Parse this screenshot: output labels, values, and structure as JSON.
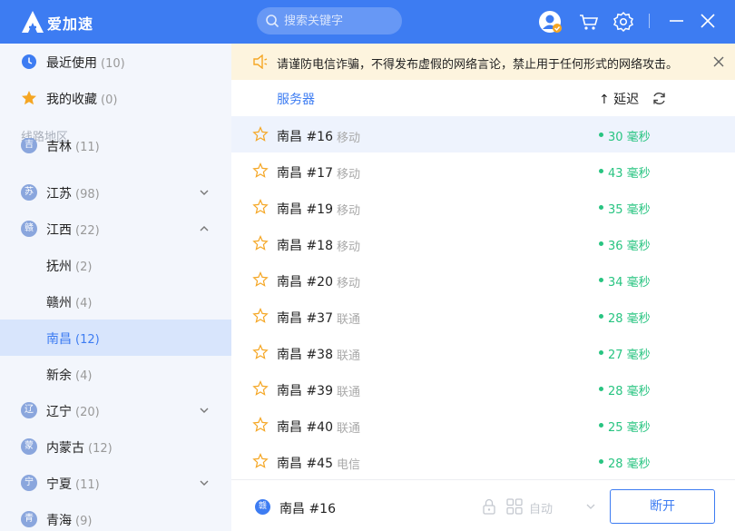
{
  "app": {
    "title": "爱加速"
  },
  "header": {
    "search_placeholder": "搜索关键字"
  },
  "sidebar": {
    "recent": {
      "label": "最近使用",
      "count": "(10)"
    },
    "favorites": {
      "label": "我的收藏",
      "count": "(0)"
    },
    "section_title": "线路地区",
    "regions": [
      {
        "badge": "吉",
        "label": "吉林",
        "count": "(11)"
      },
      {
        "badge": "苏",
        "label": "江苏",
        "count": "(98)"
      },
      {
        "badge": "赣",
        "label": "江西",
        "count": "(22)"
      },
      {
        "label": "抚州",
        "count": "(2)"
      },
      {
        "label": "赣州",
        "count": "(4)"
      },
      {
        "label": "南昌",
        "count": "(12)"
      },
      {
        "label": "新余",
        "count": "(4)"
      },
      {
        "badge": "辽",
        "label": "辽宁",
        "count": "(20)"
      },
      {
        "badge": "蒙",
        "label": "内蒙古",
        "count": "(12)"
      },
      {
        "badge": "宁",
        "label": "宁夏",
        "count": "(11)"
      },
      {
        "badge": "青",
        "label": "青海",
        "count": "(9)"
      }
    ]
  },
  "notice": {
    "text": "请谨防电信诈骗，不得发布虚假的网络言论，禁止用于任何形式的网络攻击。"
  },
  "table": {
    "col_server": "服务器",
    "col_latency": "↑ 延迟",
    "rows": [
      {
        "name": "南昌 #16",
        "isp": "移动",
        "ping": "30 毫秒"
      },
      {
        "name": "南昌 #17",
        "isp": "移动",
        "ping": "43 毫秒"
      },
      {
        "name": "南昌 #19",
        "isp": "移动",
        "ping": "35 毫秒"
      },
      {
        "name": "南昌 #18",
        "isp": "移动",
        "ping": "36 毫秒"
      },
      {
        "name": "南昌 #20",
        "isp": "移动",
        "ping": "34 毫秒"
      },
      {
        "name": "南昌 #37",
        "isp": "联通",
        "ping": "28 毫秒"
      },
      {
        "name": "南昌 #38",
        "isp": "联通",
        "ping": "27 毫秒"
      },
      {
        "name": "南昌 #39",
        "isp": "联通",
        "ping": "28 毫秒"
      },
      {
        "name": "南昌 #40",
        "isp": "联通",
        "ping": "25 毫秒"
      },
      {
        "name": "南昌 #45",
        "isp": "电信",
        "ping": "28 毫秒"
      }
    ]
  },
  "footer": {
    "badge": "赣",
    "current": "南昌 #16",
    "mode": "自动",
    "disconnect": "断开"
  },
  "colors": {
    "brand": "#3d7cf2",
    "ping": "#28c481",
    "notice_bg": "#fdf4de"
  }
}
